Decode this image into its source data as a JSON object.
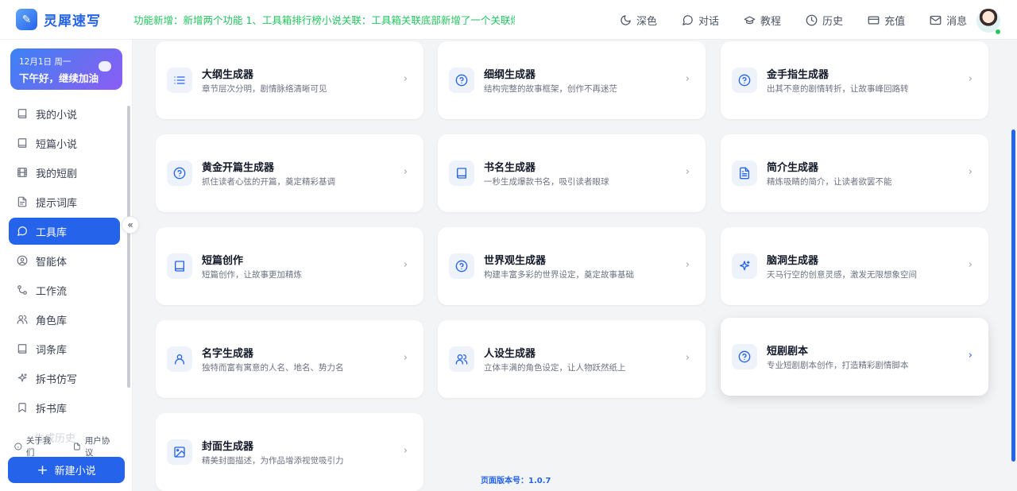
{
  "app": {
    "title": "灵犀速写"
  },
  "notice": "功能新增：新增两个功能 1、工具箱排行榜小说关联：工具箱关联底部新增了一个关联爆款...",
  "nav": [
    {
      "label": "深色",
      "icon": "moon-icon"
    },
    {
      "label": "对话",
      "icon": "chat-icon"
    },
    {
      "label": "教程",
      "icon": "graduation-cap-icon"
    },
    {
      "label": "历史",
      "icon": "clock-icon"
    },
    {
      "label": "充值",
      "icon": "credit-card-icon"
    },
    {
      "label": "消息",
      "icon": "mail-icon"
    }
  ],
  "greeting": {
    "date": "12月1日 周一",
    "message": "下午好，继续加油"
  },
  "sidebar": {
    "items": [
      {
        "label": "我的小说",
        "icon": "book-icon",
        "active": false
      },
      {
        "label": "短篇小说",
        "icon": "book-icon",
        "active": false
      },
      {
        "label": "我的短剧",
        "icon": "film-icon",
        "active": false
      },
      {
        "label": "提示词库",
        "icon": "file-icon",
        "active": false
      },
      {
        "label": "工具库",
        "icon": "chat-icon",
        "active": true
      },
      {
        "label": "智能体",
        "icon": "bot-icon",
        "active": false
      },
      {
        "label": "工作流",
        "icon": "workflow-icon",
        "active": false
      },
      {
        "label": "角色库",
        "icon": "users-icon",
        "active": false
      },
      {
        "label": "词条库",
        "icon": "book-icon",
        "active": false
      },
      {
        "label": "拆书仿写",
        "icon": "sparkle-icon",
        "active": false
      },
      {
        "label": "拆书库",
        "icon": "bookmark-icon",
        "active": false
      }
    ],
    "faded_item": "生成历史",
    "about": "关于我们",
    "agreement": "用户协议",
    "new_button": "新建小说"
  },
  "cards": [
    {
      "title": "大纲生成器",
      "desc": "章节层次分明，剧情脉络清晰可见",
      "icon": "list-icon"
    },
    {
      "title": "细纲生成器",
      "desc": "结构完整的故事框架，创作不再迷茫",
      "icon": "help-circle-icon"
    },
    {
      "title": "金手指生成器",
      "desc": "出其不意的剧情转折，让故事峰回路转",
      "icon": "help-circle-icon"
    },
    {
      "title": "黄金开篇生成器",
      "desc": "抓住读者心弦的开篇，奠定精彩基调",
      "icon": "help-circle-icon"
    },
    {
      "title": "书名生成器",
      "desc": "一秒生成爆款书名，吸引读者眼球",
      "icon": "book-icon"
    },
    {
      "title": "简介生成器",
      "desc": "精炼吸睛的简介，让读者欲罢不能",
      "icon": "file-text-icon"
    },
    {
      "title": "短篇创作",
      "desc": "短篇创作，让故事更加精炼",
      "icon": "book-icon"
    },
    {
      "title": "世界观生成器",
      "desc": "构建丰富多彩的世界设定，奠定故事基础",
      "icon": "help-circle-icon"
    },
    {
      "title": "脑洞生成器",
      "desc": "天马行空的创意灵感，激发无限想象空间",
      "icon": "sparkle-icon"
    },
    {
      "title": "名字生成器",
      "desc": "独特而富有寓意的人名、地名、势力名",
      "icon": "user-icon"
    },
    {
      "title": "人设生成器",
      "desc": "立体丰满的角色设定，让人物跃然纸上",
      "icon": "users-icon"
    },
    {
      "title": "短剧剧本",
      "desc": "专业短剧剧本创作，打造精彩剧情脚本",
      "icon": "help-circle-icon",
      "highlight": true
    },
    {
      "title": "封面生成器",
      "desc": "精美封面描述，为作品增添视觉吸引力",
      "icon": "image-icon"
    }
  ],
  "version": "页面版本号：1.0.7"
}
